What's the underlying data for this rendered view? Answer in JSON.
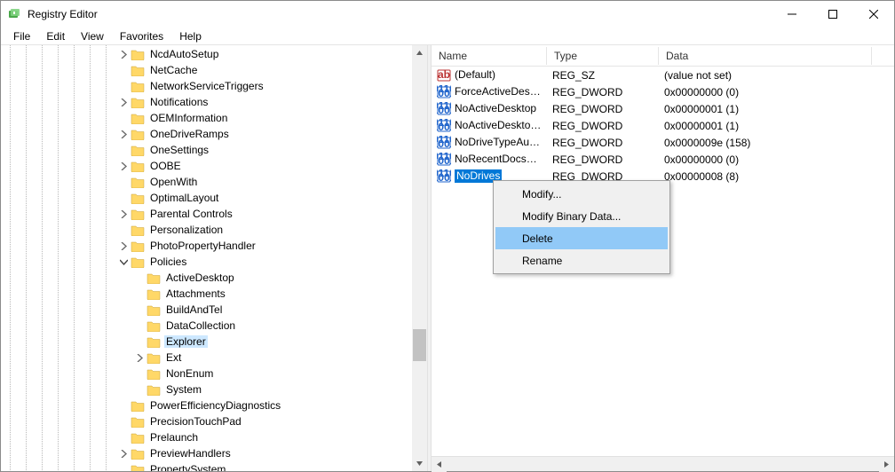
{
  "window": {
    "title": "Registry Editor"
  },
  "menu": {
    "file": "File",
    "edit": "Edit",
    "view": "View",
    "favorites": "Favorites",
    "help": "Help"
  },
  "tree": {
    "items": [
      {
        "depth": 7,
        "expander": "closed",
        "label": "NcdAutoSetup"
      },
      {
        "depth": 7,
        "expander": "none",
        "label": "NetCache"
      },
      {
        "depth": 7,
        "expander": "none",
        "label": "NetworkServiceTriggers"
      },
      {
        "depth": 7,
        "expander": "closed",
        "label": "Notifications"
      },
      {
        "depth": 7,
        "expander": "none",
        "label": "OEMInformation"
      },
      {
        "depth": 7,
        "expander": "closed",
        "label": "OneDriveRamps"
      },
      {
        "depth": 7,
        "expander": "none",
        "label": "OneSettings"
      },
      {
        "depth": 7,
        "expander": "closed",
        "label": "OOBE"
      },
      {
        "depth": 7,
        "expander": "none",
        "label": "OpenWith"
      },
      {
        "depth": 7,
        "expander": "none",
        "label": "OptimalLayout"
      },
      {
        "depth": 7,
        "expander": "closed",
        "label": "Parental Controls"
      },
      {
        "depth": 7,
        "expander": "none",
        "label": "Personalization"
      },
      {
        "depth": 7,
        "expander": "closed",
        "label": "PhotoPropertyHandler"
      },
      {
        "depth": 7,
        "expander": "open",
        "label": "Policies"
      },
      {
        "depth": 8,
        "expander": "none",
        "label": "ActiveDesktop"
      },
      {
        "depth": 8,
        "expander": "none",
        "label": "Attachments"
      },
      {
        "depth": 8,
        "expander": "none",
        "label": "BuildAndTel"
      },
      {
        "depth": 8,
        "expander": "none",
        "label": "DataCollection"
      },
      {
        "depth": 8,
        "expander": "none",
        "label": "Explorer",
        "selected": true
      },
      {
        "depth": 8,
        "expander": "closed",
        "label": "Ext"
      },
      {
        "depth": 8,
        "expander": "none",
        "label": "NonEnum"
      },
      {
        "depth": 8,
        "expander": "none",
        "label": "System"
      },
      {
        "depth": 7,
        "expander": "none",
        "label": "PowerEfficiencyDiagnostics"
      },
      {
        "depth": 7,
        "expander": "none",
        "label": "PrecisionTouchPad"
      },
      {
        "depth": 7,
        "expander": "none",
        "label": "Prelaunch"
      },
      {
        "depth": 7,
        "expander": "closed",
        "label": "PreviewHandlers"
      },
      {
        "depth": 7,
        "expander": "none",
        "label": "PropertySystem"
      }
    ]
  },
  "list": {
    "columns": {
      "name": "Name",
      "type": "Type",
      "data": "Data"
    },
    "column_widths": {
      "name": 130,
      "type": 126,
      "data": 240
    },
    "rows": [
      {
        "icon": "sz",
        "name": "(Default)",
        "type": "REG_SZ",
        "data": "(value not set)"
      },
      {
        "icon": "dword",
        "name": "ForceActiveDeskt...",
        "type": "REG_DWORD",
        "data": "0x00000000 (0)"
      },
      {
        "icon": "dword",
        "name": "NoActiveDesktop",
        "type": "REG_DWORD",
        "data": "0x00000001 (1)"
      },
      {
        "icon": "dword",
        "name": "NoActiveDesktop...",
        "type": "REG_DWORD",
        "data": "0x00000001 (1)"
      },
      {
        "icon": "dword",
        "name": "NoDriveTypeAuto...",
        "type": "REG_DWORD",
        "data": "0x0000009e (158)"
      },
      {
        "icon": "dword",
        "name": "NoRecentDocsHis...",
        "type": "REG_DWORD",
        "data": "0x00000000 (0)"
      },
      {
        "icon": "dword",
        "name": "NoDrives",
        "type": "REG_DWORD",
        "data": "0x00000008 (8)",
        "selected": true
      }
    ]
  },
  "context_menu": {
    "items": [
      {
        "label": "Modify..."
      },
      {
        "label": "Modify Binary Data..."
      },
      {
        "label": "Delete",
        "highlighted": true
      },
      {
        "label": "Rename"
      }
    ]
  }
}
